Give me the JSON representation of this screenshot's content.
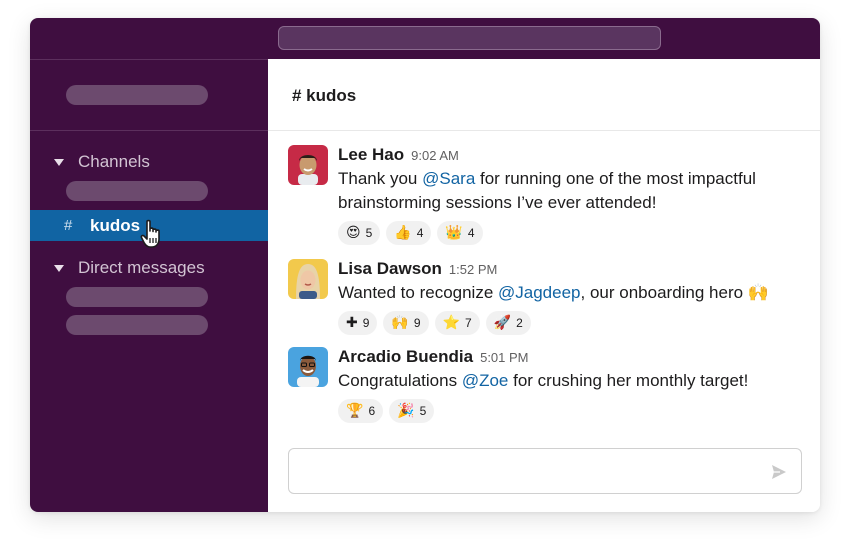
{
  "channel": {
    "name": "kudos",
    "hash": "#",
    "header_title": "# kudos"
  },
  "sidebar": {
    "channels_label": "Channels",
    "active_channel_hash": "#",
    "active_channel_name": "kudos",
    "direct_messages_label": "Direct messages"
  },
  "messages": [
    {
      "author": "Lee Hao",
      "time": "9:02 AM",
      "text_before": "Thank you ",
      "mention": "@Sara",
      "text_after": " for running one of the most impactful brainstorming sessions I’ve ever attended!",
      "reactions": [
        {
          "icon": "heart-eyes-emoji",
          "glyph": "😍",
          "count": "5"
        },
        {
          "icon": "thumbs-up-emoji",
          "glyph": "👍",
          "count": "4"
        },
        {
          "icon": "crown-emoji",
          "glyph": "👑",
          "count": "4"
        }
      ]
    },
    {
      "author": "Lisa Dawson",
      "time": "1:52 PM",
      "text_before": "Wanted to recognize ",
      "mention": "@Jagdeep",
      "text_after": ", our onboarding hero ",
      "inline_emoji": "🙌",
      "reactions": [
        {
          "icon": "plus-emoji",
          "glyph": "✚",
          "count": "9"
        },
        {
          "icon": "raised-hands-emoji",
          "glyph": "🙌",
          "count": "9"
        },
        {
          "icon": "star-emoji",
          "glyph": "⭐",
          "count": "7"
        },
        {
          "icon": "rocket-emoji",
          "glyph": "🚀",
          "count": "2"
        }
      ]
    },
    {
      "author": "Arcadio Buendia",
      "time": "5:01 PM",
      "text_before": "Congratulations ",
      "mention": "@Zoe",
      "text_after": " for crushing her monthly target!",
      "reactions": [
        {
          "icon": "trophy-emoji",
          "glyph": "🏆",
          "count": "6"
        },
        {
          "icon": "party-popper-emoji",
          "glyph": "🎉",
          "count": "5"
        }
      ]
    }
  ],
  "colors": {
    "sidebar_bg": "#3f0e40",
    "active_item": "#1164a3",
    "mention": "#1264a3",
    "placeholder_pill": "#6c4a6e"
  }
}
